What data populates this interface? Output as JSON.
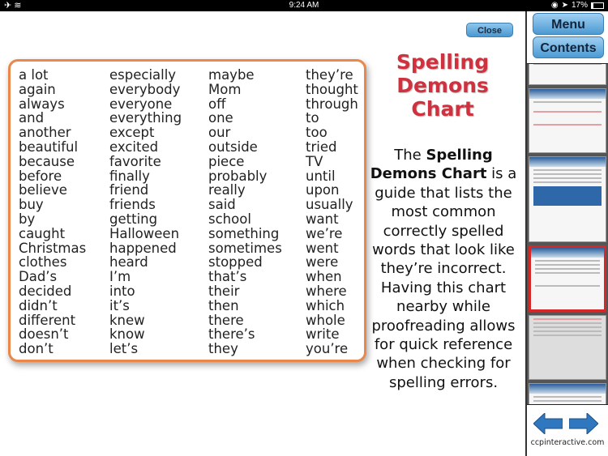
{
  "status": {
    "time": "9:24 AM",
    "battery": "17%",
    "battery_level": 0.17,
    "icons": [
      "airplane-icon",
      "wifi-icon",
      "rotation-lock-icon",
      "location-icon",
      "battery-icon"
    ]
  },
  "close_label": "Close",
  "columns": [
    [
      "a lot",
      "again",
      "always",
      "and",
      "another",
      "beautiful",
      "because",
      "before",
      "believe",
      "buy",
      "by",
      "caught",
      "Christmas",
      "clothes",
      "Dad’s",
      "decided",
      "didn’t",
      "different",
      "doesn’t",
      "don’t"
    ],
    [
      "especially",
      "everybody",
      "everyone",
      "everything",
      "except",
      "excited",
      "favorite",
      "finally",
      "friend",
      "friends",
      "getting",
      "Halloween",
      "happened",
      "heard",
      "I’m",
      "into",
      "it’s",
      "knew",
      "know",
      "let’s"
    ],
    [
      "maybe",
      "Mom",
      "off",
      "one",
      "our",
      "outside",
      "piece",
      "probably",
      "really",
      "said",
      "school",
      "something",
      "sometimes",
      "stopped",
      "that’s",
      "their",
      "then",
      "there",
      "there’s",
      "they"
    ],
    [
      "they’re",
      "thought",
      "through",
      "to",
      "too",
      "tried",
      "TV",
      "until",
      "upon",
      "usually",
      "want",
      "we’re",
      "went",
      "were",
      "when",
      "where",
      "which",
      "whole",
      "write",
      "you’re"
    ]
  ],
  "title": [
    "Spelling",
    "Demons",
    "Chart"
  ],
  "description": {
    "pre": "The ",
    "bold": "Spelling Demons Chart",
    "post": " is a guide that lists the most common correctly spelled words that look like they’re incorrect. Having this chart nearby while proofreading allows for quick reference when checking for spelling errors."
  },
  "sidebar": {
    "menu_label": "Menu",
    "contents_label": "Contents",
    "site": "ccpinteractive.com",
    "accent": "#d0313f",
    "border": "#e9884a"
  }
}
